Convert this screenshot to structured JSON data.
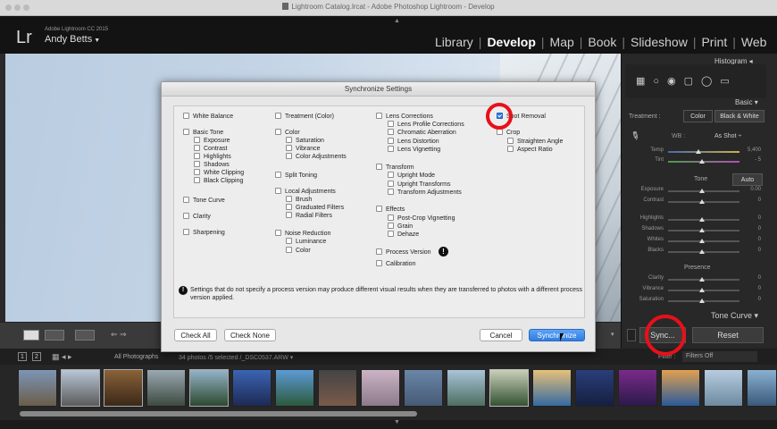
{
  "window": {
    "title": "Lightroom Catalog.lrcat - Adobe Photoshop Lightroom - Develop"
  },
  "identity": {
    "logo": "Lr",
    "product": "Adobe Lightroom CC 2015",
    "user": "Andy Betts",
    "caret": "▼"
  },
  "modules": [
    "Library",
    "Develop",
    "Map",
    "Book",
    "Slideshow",
    "Print",
    "Web"
  ],
  "active_module": "Develop",
  "right_panel": {
    "histogram": "Histogram",
    "basic": "Basic",
    "treatment_label": "Treatment :",
    "treatment_color": "Color",
    "treatment_bw": "Black & White",
    "wb_label": "WB :",
    "wb_value": "As Shot",
    "temp": {
      "label": "Temp",
      "value": "5,400"
    },
    "tint": {
      "label": "Tint",
      "value": "- 5"
    },
    "tone_label": "Tone",
    "auto": "Auto",
    "exposure": {
      "label": "Exposure",
      "value": "0.00"
    },
    "contrast": {
      "label": "Contrast",
      "value": "0"
    },
    "highlights": {
      "label": "Highlights",
      "value": "0"
    },
    "shadows": {
      "label": "Shadows",
      "value": "0"
    },
    "whites": {
      "label": "Whites",
      "value": "0"
    },
    "blacks": {
      "label": "Blacks",
      "value": "0"
    },
    "presence_label": "Presence",
    "clarity": {
      "label": "Clarity",
      "value": "0"
    },
    "vibrance": {
      "label": "Vibrance",
      "value": "0"
    },
    "saturation": {
      "label": "Saturation",
      "value": "0"
    },
    "tone_curve": "Tone Curve",
    "sync_button": "Sync...",
    "reset_button": "Reset"
  },
  "filmbar": {
    "page1": "1",
    "page2": "2",
    "source": "All Photographs",
    "info": "34 photos /5 selected /_DSC0537.ARW",
    "filter_label": "Filter :",
    "filter_value": "Filters Off"
  },
  "dialog": {
    "title": "Synchronize Settings",
    "columns": {
      "col1": [
        {
          "label": "White Balance",
          "checked": false
        },
        {
          "label": "Basic Tone",
          "checked": false
        },
        {
          "label": "Exposure",
          "checked": false
        },
        {
          "label": "Contrast",
          "checked": false
        },
        {
          "label": "Highlights",
          "checked": false
        },
        {
          "label": "Shadows",
          "checked": false
        },
        {
          "label": "White Clipping",
          "checked": false
        },
        {
          "label": "Black Clipping",
          "checked": false
        },
        {
          "label": "Tone Curve",
          "checked": false
        },
        {
          "label": "Clarity",
          "checked": false
        },
        {
          "label": "Sharpening",
          "checked": false
        }
      ],
      "col2": [
        {
          "label": "Treatment (Color)",
          "checked": false
        },
        {
          "label": "Color",
          "checked": false
        },
        {
          "label": "Saturation",
          "checked": false
        },
        {
          "label": "Vibrance",
          "checked": false
        },
        {
          "label": "Color Adjustments",
          "checked": false
        },
        {
          "label": "Split Toning",
          "checked": false
        },
        {
          "label": "Local Adjustments",
          "checked": false
        },
        {
          "label": "Brush",
          "checked": false
        },
        {
          "label": "Graduated Filters",
          "checked": false
        },
        {
          "label": "Radial Filters",
          "checked": false
        },
        {
          "label": "Noise Reduction",
          "checked": false
        },
        {
          "label": "Luminance",
          "checked": false
        },
        {
          "label": "Color",
          "checked": false
        }
      ],
      "col3": [
        {
          "label": "Lens Corrections",
          "checked": false
        },
        {
          "label": "Lens Profile Corrections",
          "checked": false
        },
        {
          "label": "Chromatic Aberration",
          "checked": false
        },
        {
          "label": "Lens Distortion",
          "checked": false
        },
        {
          "label": "Lens Vignetting",
          "checked": false
        },
        {
          "label": "Transform",
          "checked": false
        },
        {
          "label": "Upright Mode",
          "checked": false
        },
        {
          "label": "Upright Transforms",
          "checked": false
        },
        {
          "label": "Transform Adjustments",
          "checked": false
        },
        {
          "label": "Effects",
          "checked": false
        },
        {
          "label": "Post-Crop Vignetting",
          "checked": false
        },
        {
          "label": "Grain",
          "checked": false
        },
        {
          "label": "Dehaze",
          "checked": false
        },
        {
          "label": "Process Version",
          "checked": false
        },
        {
          "label": "Calibration",
          "checked": false
        }
      ],
      "col4": [
        {
          "label": "Spot Removal",
          "checked": true
        },
        {
          "label": "Crop",
          "checked": false
        },
        {
          "label": "Straighten Angle",
          "checked": false
        },
        {
          "label": "Aspect Ratio",
          "checked": false
        }
      ]
    },
    "info_text": "Settings that do not specify a process version may produce different visual results when they are transferred to photos with a different process version applied.",
    "buttons": {
      "check_all": "Check All",
      "check_none": "Check None",
      "cancel": "Cancel",
      "synchronize": "Synchronize"
    }
  },
  "colors": {
    "accent": "#2f7de1",
    "highlight_ring": "#e8101a"
  }
}
